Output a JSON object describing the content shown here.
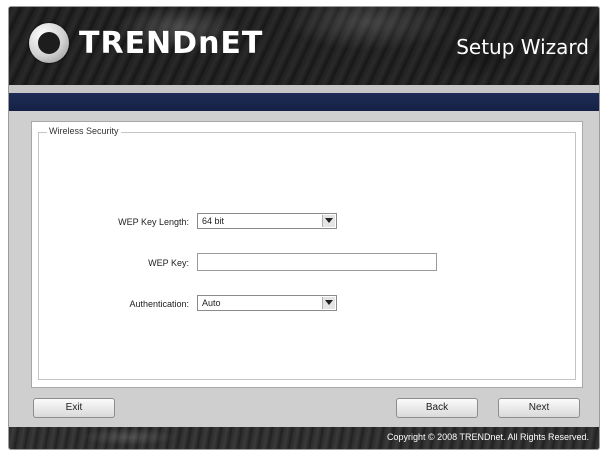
{
  "banner": {
    "logo_text": "TRENDnET",
    "title": "Setup Wizard"
  },
  "section": {
    "legend": "Wireless Security"
  },
  "form": {
    "wep_key_length": {
      "label": "WEP Key Length:",
      "value": "64 bit",
      "icon": "chevron-down-icon"
    },
    "wep_key": {
      "label": "WEP Key:",
      "value": ""
    },
    "authentication": {
      "label": "Authentication:",
      "value": "Auto",
      "icon": "chevron-down-icon"
    }
  },
  "buttons": {
    "exit": "Exit",
    "back": "Back",
    "next": "Next"
  },
  "footer": {
    "copyright": "Copyright © 2008 TRENDnet. All Rights Reserved."
  },
  "colors": {
    "banner_dark": "#202020",
    "strip_navy": "#1f2c55",
    "content_bg": "#ffffff"
  }
}
